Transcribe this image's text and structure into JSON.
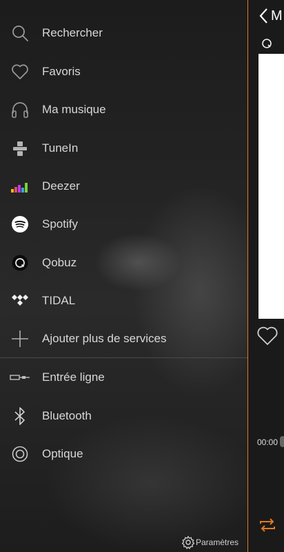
{
  "menu": {
    "items": [
      {
        "label": "Rechercher",
        "icon": "search-icon"
      },
      {
        "label": "Favoris",
        "icon": "heart-icon"
      },
      {
        "label": "Ma musique",
        "icon": "headphones-icon"
      },
      {
        "label": "TuneIn",
        "icon": "tunein-icon"
      },
      {
        "label": "Deezer",
        "icon": "deezer-icon"
      },
      {
        "label": "Spotify",
        "icon": "spotify-icon"
      },
      {
        "label": "Qobuz",
        "icon": "qobuz-icon"
      },
      {
        "label": "TIDAL",
        "icon": "tidal-icon"
      },
      {
        "label": "Ajouter plus de services",
        "icon": "plus-icon"
      }
    ],
    "inputs": [
      {
        "label": "Entrée ligne",
        "icon": "line-in-icon"
      },
      {
        "label": "Bluetooth",
        "icon": "bluetooth-icon"
      },
      {
        "label": "Optique",
        "icon": "optical-icon"
      }
    ]
  },
  "footer": {
    "settings_label": "Paramètres",
    "settings_icon": "gear-icon"
  },
  "player": {
    "title_fragment": "M",
    "time": "00:00",
    "accent_color": "#e07b1f"
  }
}
